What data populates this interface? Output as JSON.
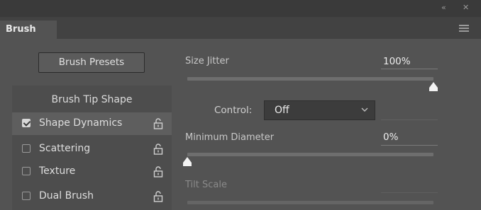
{
  "window": {
    "collapse_icon": "double-chevron-left-icon",
    "close_icon": "close-icon"
  },
  "tab": {
    "label": "Brush"
  },
  "panel_menu_icon": "hamburger-menu-icon",
  "buttons": {
    "brush_presets": "Brush Presets"
  },
  "brush_list": {
    "header": "Brush Tip Shape",
    "items": [
      {
        "label": "Shape Dynamics",
        "checked": true,
        "selected": true,
        "icon": "lock-open-icon"
      },
      {
        "label": "Scattering",
        "checked": false,
        "selected": false,
        "icon": "lock-open-icon"
      },
      {
        "label": "Texture",
        "checked": false,
        "selected": false,
        "icon": "lock-open-icon"
      },
      {
        "label": "Dual Brush",
        "checked": false,
        "selected": false,
        "icon": "lock-open-icon"
      }
    ]
  },
  "settings": {
    "size_jitter": {
      "label": "Size Jitter",
      "value": "100%",
      "slider_fraction": 1.0
    },
    "control": {
      "label": "Control:",
      "selected": "Off"
    },
    "minimum_diameter": {
      "label": "Minimum Diameter",
      "value": "0%",
      "slider_fraction": 0.0
    },
    "tilt_scale": {
      "label": "Tilt Scale",
      "value": ""
    }
  }
}
